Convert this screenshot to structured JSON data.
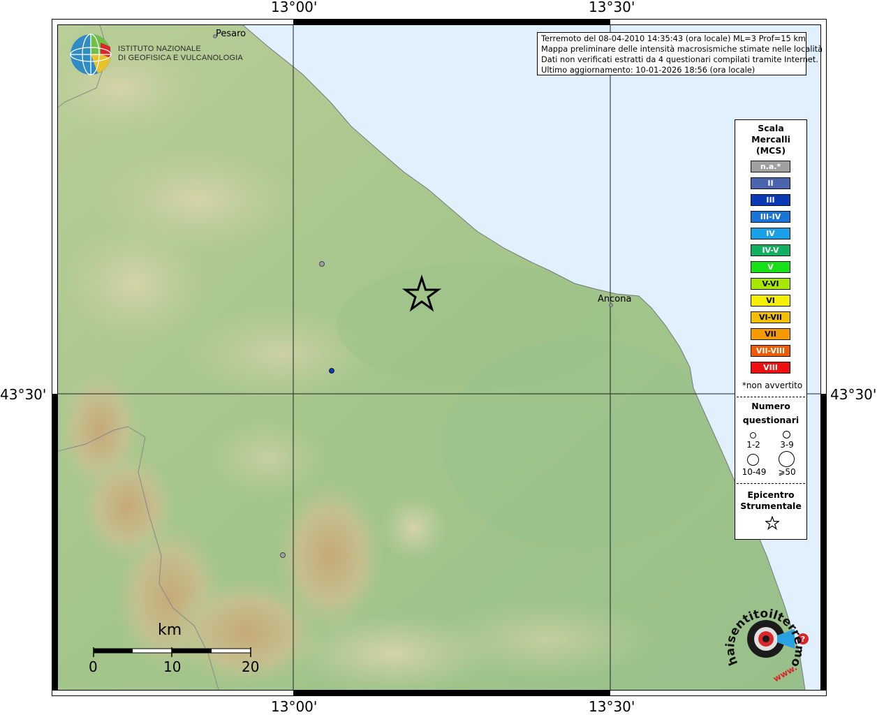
{
  "coords": {
    "top": [
      "13°00'",
      "13°30'"
    ],
    "bottom": [
      "13°00'",
      "13°30'"
    ],
    "left": "43°30'",
    "right": "43°30'"
  },
  "places": {
    "pesaro": "Pesaro",
    "ancona": "Ancona"
  },
  "logo": {
    "line1": "ISTITUTO NAZIONALE",
    "line2": "DI GEOFISICA E VULCANOLOGIA"
  },
  "info": {
    "line1": "Terremoto del 08-04-2010 14:35:43 (ora locale) ML=3 Prof=15 km",
    "line2": "Mappa preliminare delle intensità macrosismiche stimate nelle località",
    "line3": "Dati non verificati estratti da 4 questionari compilati tramite Internet.",
    "line4": "Ultimo aggiornamento: 10-01-2026 18:56 (ora locale)"
  },
  "legend": {
    "title1": "Scala",
    "title2": "Mercalli",
    "title3": "(MCS)",
    "intensities": [
      {
        "label": "n.a.*",
        "color": "#a0a0a0"
      },
      {
        "label": "II",
        "color": "#4a64ad"
      },
      {
        "label": "III",
        "color": "#0b38b5"
      },
      {
        "label": "III-IV",
        "color": "#1a74d6"
      },
      {
        "label": "IV",
        "color": "#1aa0e6"
      },
      {
        "label": "IV-V",
        "color": "#10b060"
      },
      {
        "label": "V",
        "color": "#17e017"
      },
      {
        "label": "V-VI",
        "color": "#a8e800"
      },
      {
        "label": "VI",
        "color": "#f5f000"
      },
      {
        "label": "VI-VII",
        "color": "#f5c000"
      },
      {
        "label": "VII",
        "color": "#f59a00"
      },
      {
        "label": "VII-VIII",
        "color": "#f05a00"
      },
      {
        "label": "VIII",
        "color": "#ee1010"
      }
    ],
    "na_note": "*non avvertito",
    "count_title1": "Numero",
    "count_title2": "questionari",
    "count_labels": [
      "1-2",
      "3-9",
      "10-49",
      "⩾50"
    ],
    "epi_title1": "Epicentro",
    "epi_title2": "Strumentale"
  },
  "scale": {
    "unit": "km",
    "labels": [
      "0",
      "10",
      "20"
    ]
  },
  "watermark": {
    "text": "haisentitoilterremoto.it",
    "prefix": "www."
  },
  "colors": {
    "sea": "#e0f0fc",
    "land": "#a9c68e"
  }
}
